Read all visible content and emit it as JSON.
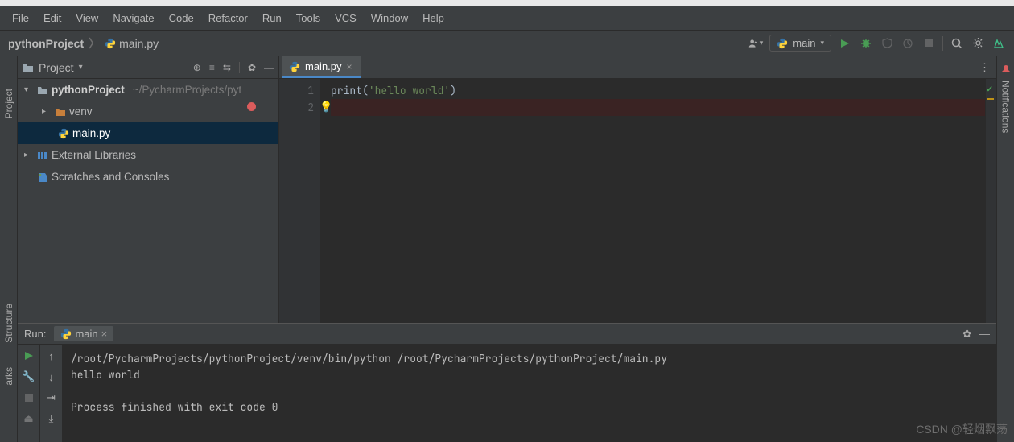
{
  "menubar": [
    "File",
    "Edit",
    "View",
    "Navigate",
    "Code",
    "Refactor",
    "Run",
    "Tools",
    "VCS",
    "Window",
    "Help"
  ],
  "breadcrumb": {
    "root": "pythonProject",
    "file": "main.py"
  },
  "run_config": {
    "label": "main"
  },
  "project_panel": {
    "title": "Project",
    "root": "pythonProject",
    "root_path": "~/PycharmProjects/pyt",
    "venv": "venv",
    "file": "main.py",
    "external": "External Libraries",
    "scratches": "Scratches and Consoles"
  },
  "editor": {
    "tab_label": "main.py",
    "lines": [
      "1",
      "2"
    ],
    "code_segments": {
      "fn": "print",
      "open": "(",
      "str": "'hello world'",
      "close": ")"
    }
  },
  "run_panel": {
    "title": "Run:",
    "config": "main",
    "output_cmd": "/root/PycharmProjects/pythonProject/venv/bin/python /root/PycharmProjects/pythonProject/main.py",
    "output_stdout": "hello world",
    "output_exit": "Process finished with exit code 0"
  },
  "side_left": {
    "project": "Project",
    "structure": "Structure",
    "marks": "arks"
  },
  "side_right": {
    "notifications": "Notifications"
  },
  "watermark": "CSDN @轻烟飘荡"
}
